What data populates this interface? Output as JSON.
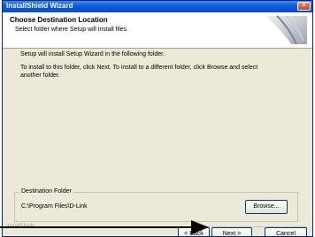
{
  "window": {
    "title": "InstallShield Wizard",
    "close_glyph": "×"
  },
  "header": {
    "title": "Choose Destination Location",
    "subtitle": "Select folder where Setup will install files."
  },
  "body": {
    "line1": "Setup will install Setup Wizard in the following folder.",
    "line2": "To install to this folder, click Next. To install to a different folder, click Browse and select",
    "line3": "another folder."
  },
  "destination": {
    "label": "Destination Folder",
    "path": "C:\\Program Files\\D-Link",
    "browse_label": "Browse..."
  },
  "footer": {
    "brand": "InstallShield",
    "back_label": "< Back",
    "next_label": "Next >",
    "cancel_label": "Cancel"
  },
  "colors": {
    "titlebar": "#0a5ad8",
    "dialog_bg": "#ece9d8",
    "button_border": "#003c74"
  },
  "icons": {
    "close": "close-icon",
    "header_graphic": "installshield-decor-graphic",
    "pointer": "arrow-pointer"
  }
}
